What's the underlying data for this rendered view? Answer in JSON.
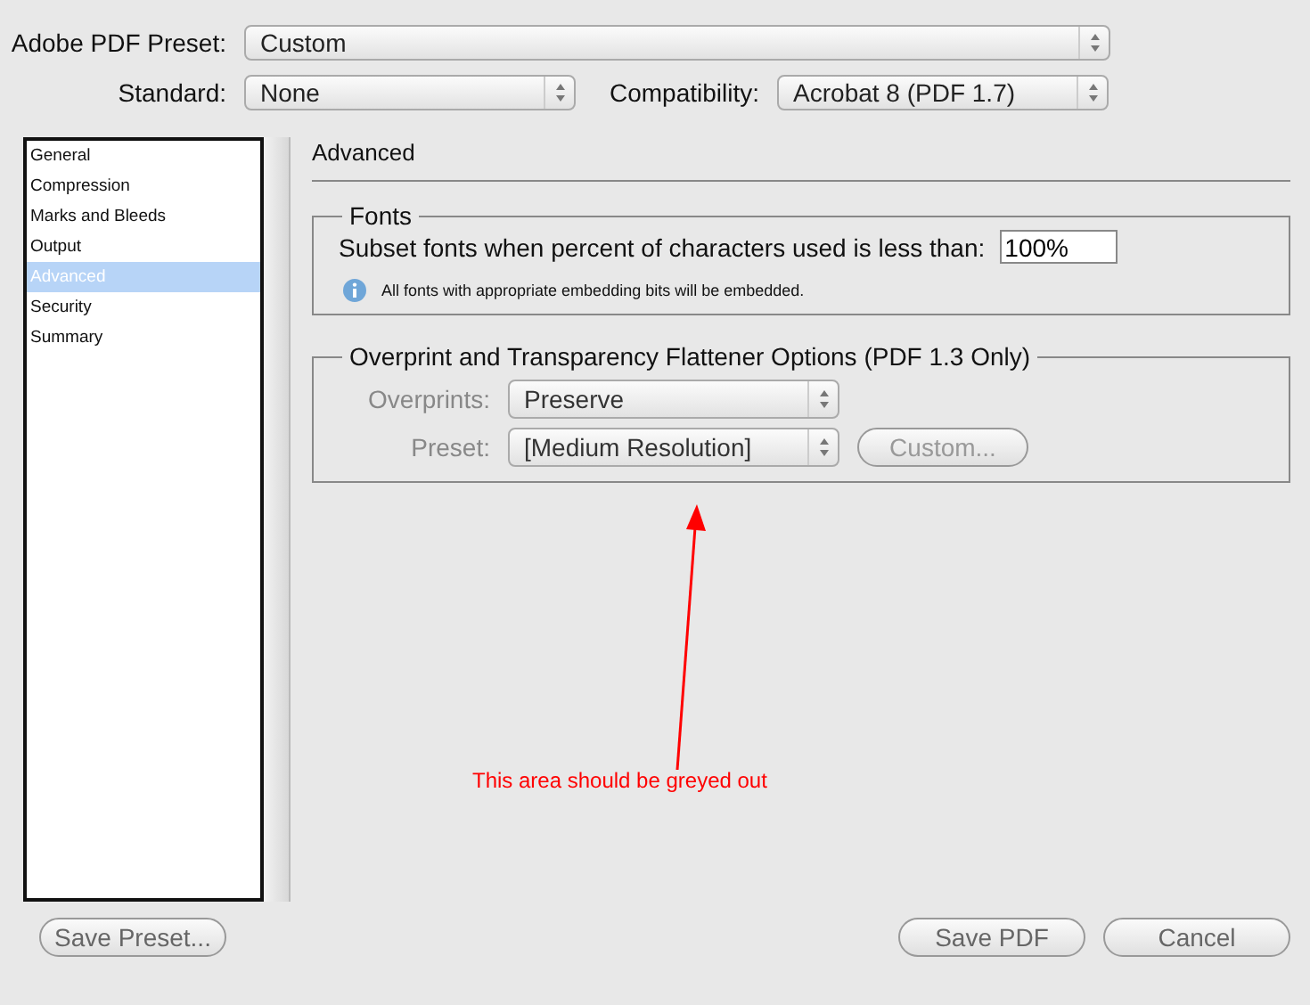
{
  "preset": {
    "label": "Adobe PDF Preset:",
    "value": "Custom"
  },
  "standard": {
    "label": "Standard:",
    "value": "None"
  },
  "compatibility": {
    "label": "Compatibility:",
    "value": "Acrobat 8 (PDF 1.7)"
  },
  "sidebar": {
    "items": [
      {
        "label": "General",
        "selected": false
      },
      {
        "label": "Compression",
        "selected": false
      },
      {
        "label": "Marks and Bleeds",
        "selected": false
      },
      {
        "label": "Output",
        "selected": false
      },
      {
        "label": "Advanced",
        "selected": true
      },
      {
        "label": "Security",
        "selected": false
      },
      {
        "label": "Summary",
        "selected": false
      }
    ]
  },
  "panel": {
    "title": "Advanced",
    "fonts": {
      "title": "Fonts",
      "subset_label": "Subset fonts when percent of characters used is less than:",
      "subset_value": "100%",
      "info": "All fonts with appropriate embedding bits will be embedded."
    },
    "overprint": {
      "title": "Overprint and Transparency Flattener Options (PDF 1.3 Only)",
      "disabled": true,
      "overprints": {
        "label": "Overprints:",
        "value": "Preserve"
      },
      "preset": {
        "label": "Preset:",
        "value": "[Medium Resolution]"
      },
      "custom_button": "Custom..."
    }
  },
  "annotation": {
    "text": "This area should be greyed out"
  },
  "buttons": {
    "save_preset": "Save Preset...",
    "save_pdf": "Save PDF",
    "cancel": "Cancel"
  }
}
